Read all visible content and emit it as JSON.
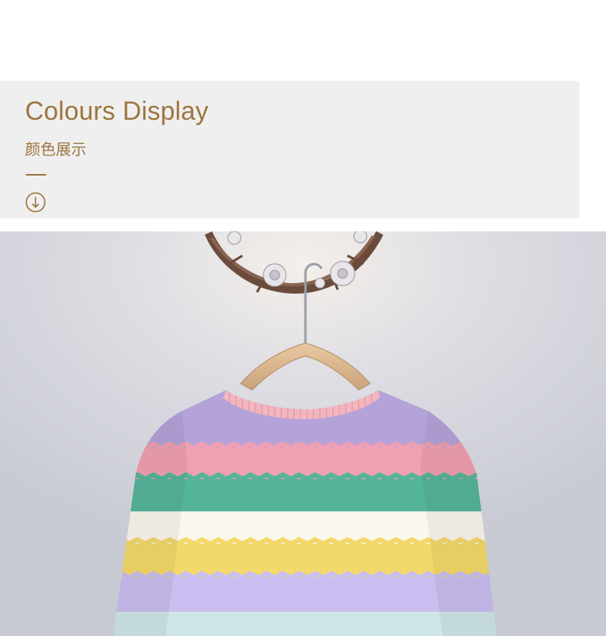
{
  "banner": {
    "title": "Colours Display",
    "subtitle": "颜色展示",
    "arrow_icon": "down-arrow-circle-icon"
  },
  "colors": {
    "accent": "#9c7540",
    "banner_bg": "#efefef",
    "wall": "#d4d5dc",
    "stripes": [
      "#b4a3d9",
      "#f0a0b0",
      "#55b59a",
      "#fbf6ee",
      "#f3d96a",
      "#cabdf0",
      "#cfe6e6"
    ]
  },
  "photo": {
    "subject": "sweater-photo"
  }
}
